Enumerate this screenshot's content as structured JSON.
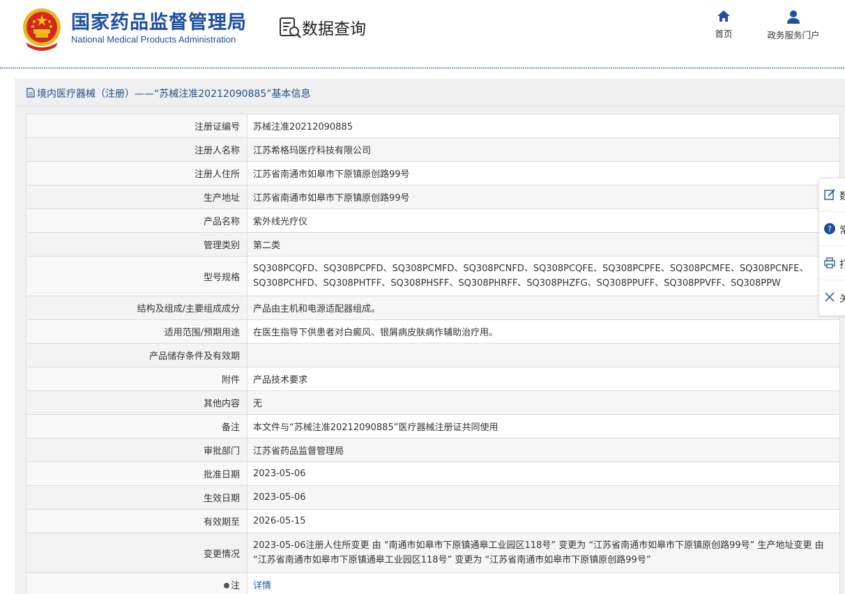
{
  "header": {
    "logo_cn": "国家药品监督管理局",
    "logo_en": "National Medical Products Administration",
    "query_title": "数据查询",
    "nav": {
      "home": "首页",
      "portal": "政务服务门户"
    }
  },
  "panel": {
    "title": "境内医疗器械（注册）——“苏械注准20212090885”基本信息"
  },
  "rows": [
    {
      "label": "注册证编号",
      "value": "苏械注准20212090885"
    },
    {
      "label": "注册人名称",
      "value": "江苏希格玛医疗科技有限公司"
    },
    {
      "label": "注册人住所",
      "value": "江苏省南通市如皋市下原镇原创路99号"
    },
    {
      "label": "生产地址",
      "value": "江苏省南通市如皋市下原镇原创路99号"
    },
    {
      "label": "产品名称",
      "value": "紫外线光疗仪"
    },
    {
      "label": "管理类别",
      "value": "第二类"
    },
    {
      "label": "型号规格",
      "value": "SQ308PCQFD、SQ308PCPFD、SQ308PCMFD、SQ308PCNFD、SQ308PCQFE、SQ308PCPFE、SQ308PCMFE、SQ308PCNFE、SQ308PCHFD、SQ308PHTFF、SQ308PHSFF、SQ308PHRFF、SQ308PHZFG、SQ308PPUFF、SQ308PPVFF、SQ308PPW"
    },
    {
      "label": "结构及组成/主要组成成分",
      "value": "产品由主机和电源适配器组成。"
    },
    {
      "label": "适用范围/预期用途",
      "value": "在医生指导下供患者对白癜风、银屑病皮肤病作辅助治疗用。"
    },
    {
      "label": "产品储存条件及有效期",
      "value": ""
    },
    {
      "label": "附件",
      "value": "产品技术要求"
    },
    {
      "label": "其他内容",
      "value": "无"
    },
    {
      "label": "备注",
      "value": "本文件与“苏械注准20212090885”医疗器械注册证共同使用"
    },
    {
      "label": "审批部门",
      "value": "江苏省药品监督管理局"
    },
    {
      "label": "批准日期",
      "value": "2023-05-06"
    },
    {
      "label": "生效日期",
      "value": "2023-05-06"
    },
    {
      "label": "有效期至",
      "value": "2026-05-15"
    },
    {
      "label": "变更情况",
      "value": "2023-05-06注册人住所变更 由 “南通市如皋市下原镇通皋工业园区118号” 变更为 “江苏省南通市如皋市下原镇原创路99号” 生产地址变更 由 “江苏省南通市如皋市下原镇通皋工业园区118号” 变更为 “江苏省南通市如皋市下原镇原创路99号”"
    },
    {
      "label": "注",
      "value": "详情"
    }
  ],
  "sidebar": {
    "items": [
      "数",
      "常",
      "打",
      "关"
    ]
  },
  "colors": {
    "brand_blue": "#1c4fa0",
    "link_blue": "#1a5aa6",
    "emblem_red": "#d7261b",
    "emblem_gold": "#f2c21b"
  }
}
